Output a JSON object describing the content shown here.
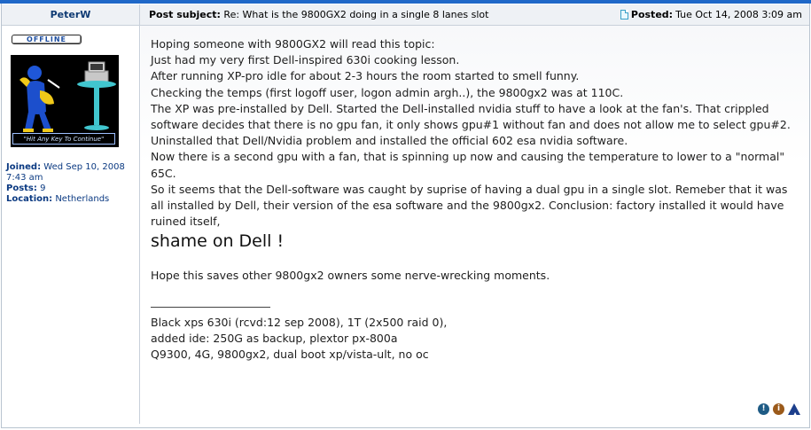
{
  "header": {
    "author": "PeterW",
    "subject_label": "Post subject:",
    "subject": "Re: What is the 9800GX2 doing in a single 8 lanes slot",
    "posted_label": "Posted:",
    "posted": "Tue Oct 14, 2008 3:09 am"
  },
  "author": {
    "status": "Offline",
    "avatar_caption": "\"Hit Any Key To Continue\"",
    "joined_label": "Joined:",
    "joined": "Wed Sep 10, 2008 7:43 am",
    "posts_label": "Posts:",
    "posts": "9",
    "location_label": "Location:",
    "location": "Netherlands"
  },
  "post": {
    "lines": [
      "Hoping someone with 9800GX2 will read this topic:",
      "Just had my very first Dell-inspired 630i cooking lesson.",
      "After running XP-pro idle for about 2-3 hours the room started to smell funny.",
      "Checking the temps (first logoff user, logon admin argh..), the 9800gx2 was at 110C.",
      "The XP was pre-installed by Dell. Started the Dell-installed nvidia stuff to have a look at the fan's. That crippled software decides that there is no gpu fan, it only shows gpu#1 without fan and does not allow me to select gpu#2.",
      "Uninstalled that Dell/Nvidia problem and installed the official 602 esa nvidia software.",
      "Now there is a second gpu with a fan, that is spinning up now and causing the temperature to lower to a \"normal\" 65C.",
      "So it seems that the Dell-software was caught by suprise of having a dual gpu in a single slot. Remeber that it was all installed by Dell, their version of the esa software and the 9800gx2. Conclusion: factory installed it would have ruined itself,"
    ],
    "emphasis": "shame on Dell !",
    "closing": "Hope this saves other 9800gx2 owners some nerve-wrecking moments.",
    "signature": [
      "Black xps 630i (rcvd:12 sep 2008), 1T (2x500 raid 0),",
      "added ide: 250G as backup, plextor px-800a",
      "Q9300, 4G, 9800gx2, dual boot xp/vista-ult, no oc"
    ]
  },
  "icons": {
    "info": "!",
    "about": "i",
    "top": "▲"
  },
  "colors": {
    "accent": "#1f68c8",
    "link": "#0b3a82"
  }
}
